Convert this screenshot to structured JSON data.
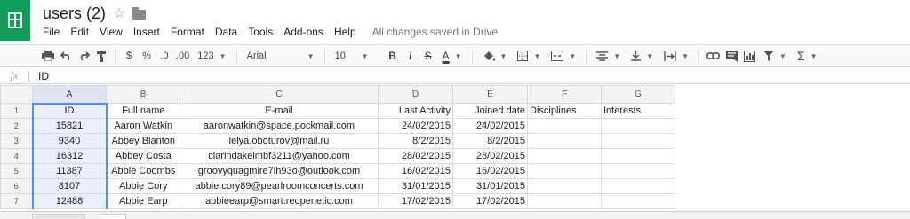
{
  "app": {
    "title": "users (2)",
    "save_status": "All changes saved in Drive"
  },
  "menu": [
    "File",
    "Edit",
    "View",
    "Insert",
    "Format",
    "Data",
    "Tools",
    "Add-ons",
    "Help"
  ],
  "toolbar": {
    "currency": "$",
    "percent": "%",
    "decrease_decimals": ".0",
    "increase_decimals": ".00",
    "more_formats": "123",
    "font_family": "Arial",
    "font_size": "10",
    "bold": "B",
    "italic": "I",
    "strikethrough": "S",
    "text_color": "A",
    "sum": "Σ"
  },
  "formula_bar": {
    "fx": "fx",
    "value": "ID"
  },
  "sheet": {
    "columns": [
      "A",
      "B",
      "C",
      "D",
      "E",
      "F",
      "G"
    ],
    "rows": [
      {
        "n": "1",
        "cells": [
          "ID",
          "Full name",
          "E-mail",
          "Last Activity",
          "Joined date",
          "Disciplines",
          "Interests"
        ]
      },
      {
        "n": "2",
        "cells": [
          "15821",
          "Aaron Watkin",
          "aaronwatkin@space.pockmail.com",
          "24/02/2015",
          "24/02/2015",
          "",
          ""
        ]
      },
      {
        "n": "3",
        "cells": [
          "9340",
          "Abbey Blanton",
          "lelya.oboturov@mail.ru",
          "8/2/2015",
          "8/2/2015",
          "",
          ""
        ]
      },
      {
        "n": "4",
        "cells": [
          "16312",
          "Abbey Costa",
          "clarindakelmbf3211@yahoo.com",
          "28/02/2015",
          "28/02/2015",
          "",
          ""
        ]
      },
      {
        "n": "5",
        "cells": [
          "11387",
          "Abbie Coombs",
          "groovyquagmire7lh93o@outlook.com",
          "16/02/2015",
          "16/02/2015",
          "",
          ""
        ]
      },
      {
        "n": "6",
        "cells": [
          "8107",
          "Abbie Cory",
          "abbie.cory89@pearlroomconcerts.com",
          "31/01/2015",
          "31/01/2015",
          "",
          ""
        ]
      },
      {
        "n": "7",
        "cells": [
          "12488",
          "Abbie Earp",
          "abbieearp@smart.reopenetic.com",
          "17/02/2015",
          "17/02/2015",
          "",
          ""
        ]
      }
    ]
  },
  "colors": {
    "brand": "#0f9d58",
    "selection": "#4d90fe"
  }
}
